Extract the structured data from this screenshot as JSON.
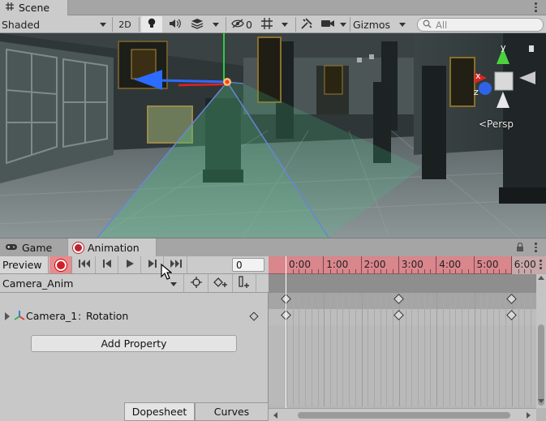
{
  "scene": {
    "tab_label": "Scene",
    "draw_mode": "Shaded",
    "toggle_2d": "2D",
    "hidden_count": "0",
    "gizmos_label": "Gizmos",
    "search_placeholder": "All",
    "persp_label": "<Persp",
    "axis_labels": {
      "y": "y",
      "x": "x",
      "z": "z"
    }
  },
  "animation_window": {
    "tabs": [
      {
        "label": "Game",
        "icon": "gamepad-icon"
      },
      {
        "label": "Animation",
        "icon": "record-circle-icon",
        "active": true
      }
    ],
    "preview_label": "Preview",
    "frame_value": "0",
    "clip_name": "Camera_Anim",
    "property": {
      "object": "Camera_1",
      "separator": " : ",
      "property": "Rotation"
    },
    "add_property_label": "Add Property",
    "bottom_tabs": [
      "Dopesheet",
      "Curves"
    ],
    "timeline": {
      "time_labels": [
        "0:00",
        "1:00",
        "2:00",
        "3:00",
        "4:00",
        "5:00",
        "6:00"
      ],
      "keyframe_times": [
        0,
        3,
        6
      ]
    },
    "colors": {
      "record_red": "#d11f2a",
      "ruler_record_tint": "#d9868c"
    }
  }
}
